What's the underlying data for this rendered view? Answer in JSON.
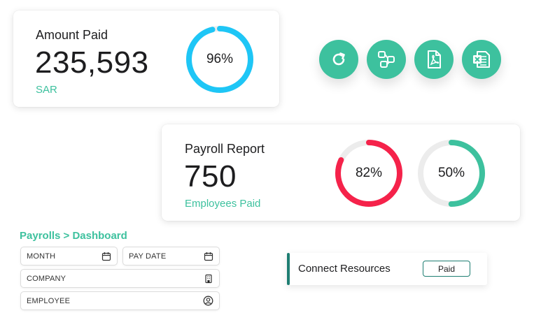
{
  "amount_card": {
    "title": "Amount Paid",
    "value": "235,593",
    "currency": "SAR",
    "progress_percent": 96,
    "progress_label": "96%",
    "ring_color": "#1ec6f6"
  },
  "actions": [
    {
      "name": "refresh-button",
      "icon": "refresh-icon"
    },
    {
      "name": "share-button",
      "icon": "share-nodes-icon"
    },
    {
      "name": "pdf-export-button",
      "icon": "pdf-file-icon"
    },
    {
      "name": "excel-export-button",
      "icon": "excel-file-icon"
    }
  ],
  "payroll_card": {
    "title": "Payroll Report",
    "value": "750",
    "subtitle": "Employees Paid",
    "ring1_percent": 82,
    "ring1_label": "82%",
    "ring1_color": "#f5224a",
    "ring2_percent": 50,
    "ring2_label": "50%",
    "ring2_color": "#3dc19e"
  },
  "filters": {
    "breadcrumb": "Payrolls > Dashboard",
    "month_label": "MONTH",
    "pay_date_label": "PAY DATE",
    "company_label": "COMPANY",
    "employee_label": "EMPLOYEE"
  },
  "resources": {
    "label": "Connect Resources",
    "status": "Paid"
  },
  "colors": {
    "accent": "#3dc19e",
    "dark_accent": "#1e7e72",
    "track": "#ececec"
  }
}
